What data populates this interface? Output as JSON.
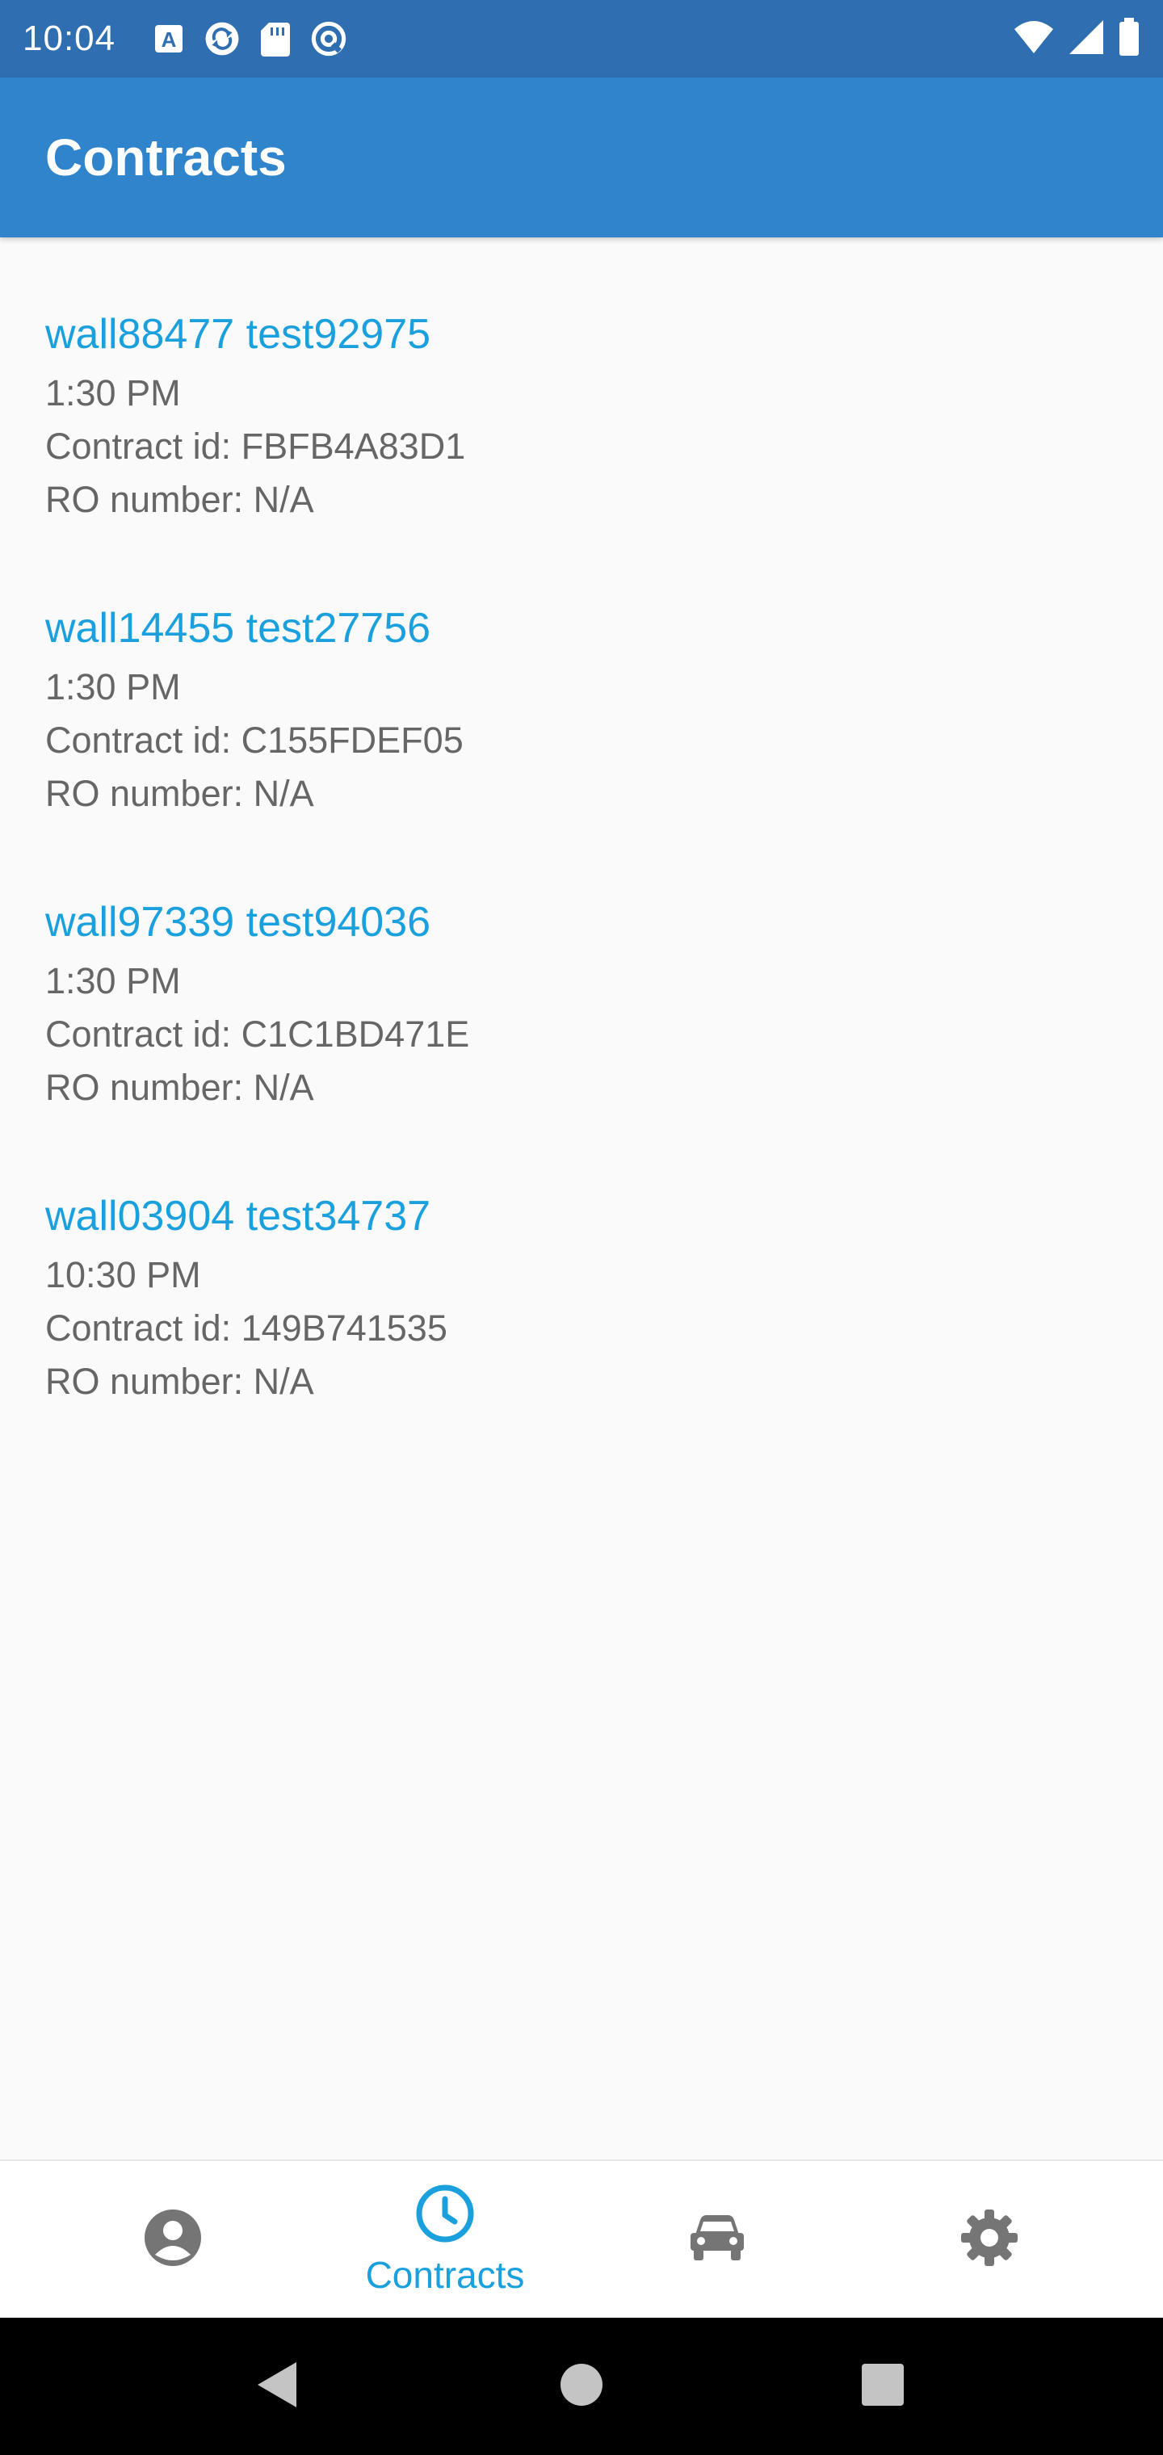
{
  "status_bar": {
    "time": "10:04",
    "left_icons": [
      "a-notification-icon",
      "sync-icon",
      "sd-card-icon",
      "at-sign-icon"
    ],
    "right_icons": [
      "wifi-icon",
      "signal-icon",
      "battery-icon"
    ]
  },
  "app_bar": {
    "title": "Contracts",
    "color": "#2f84cc"
  },
  "contracts": [
    {
      "name": "wall88477 test92975",
      "time": "1:30 PM",
      "contract_id": "Contract id: FBFB4A83D1",
      "ro_number": "RO number: N/A"
    },
    {
      "name": "wall14455 test27756",
      "time": "1:30 PM",
      "contract_id": "Contract id: C155FDEF05",
      "ro_number": "RO number: N/A"
    },
    {
      "name": "wall97339 test94036",
      "time": "1:30 PM",
      "contract_id": "Contract id: C1C1BD471E",
      "ro_number": "RO number: N/A"
    },
    {
      "name": "wall03904 test34737",
      "time": "10:30 PM",
      "contract_id": "Contract id: 149B741535",
      "ro_number": "RO number: N/A"
    }
  ],
  "bottom_nav": {
    "items": [
      {
        "icon": "account-icon",
        "label": "",
        "active": false
      },
      {
        "icon": "clock-icon",
        "label": "Contracts",
        "active": true
      },
      {
        "icon": "car-icon",
        "label": "",
        "active": false
      },
      {
        "icon": "gear-icon",
        "label": "",
        "active": false
      }
    ],
    "active_color": "#1ba0de",
    "inactive_color": "#757575"
  },
  "system_nav": {
    "buttons": [
      "back-icon",
      "home-icon",
      "recents-icon"
    ]
  },
  "colors": {
    "accent": "#1ba0de",
    "status_bar": "#2f6fb1",
    "background": "#fafafa"
  }
}
